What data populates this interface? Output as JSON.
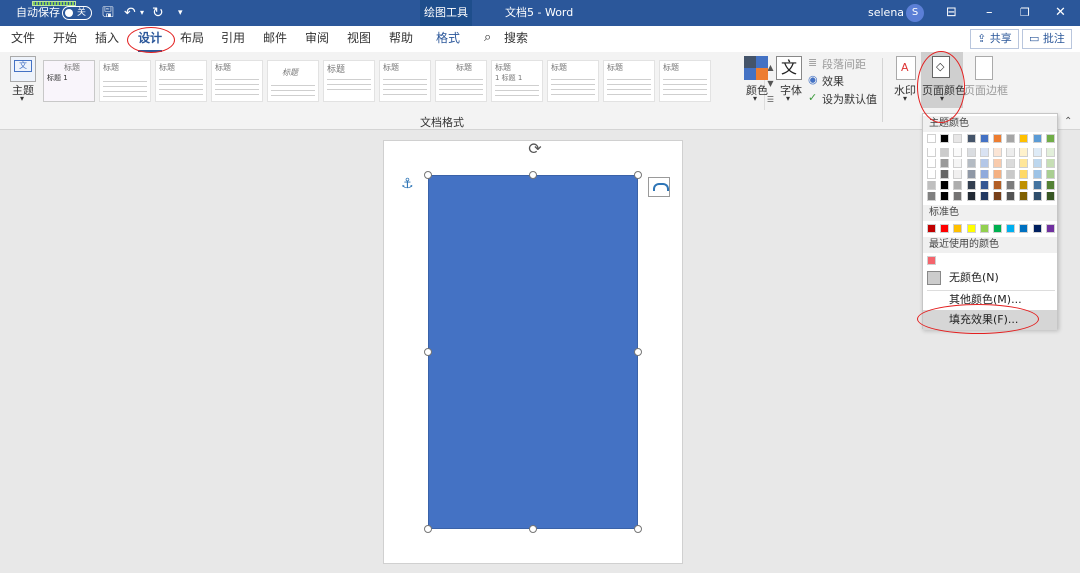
{
  "titlebar": {
    "autosave_label": "自动保存",
    "autosave_toggle": "关",
    "context_tab": "绘图工具",
    "doc_title": "文档5  -  Word",
    "user_name": "selena",
    "user_initial": "S"
  },
  "tabs": [
    "文件",
    "开始",
    "插入",
    "设计",
    "布局",
    "引用",
    "邮件",
    "审阅",
    "视图",
    "帮助",
    "格式"
  ],
  "active_tab": "设计",
  "search_label": "搜索",
  "share_label": "共享",
  "comment_label": "批注",
  "ribbon": {
    "theme_label": "主题",
    "style_gallery": [
      "标题 1",
      "标题",
      "标题",
      "标题",
      "标题",
      "标题",
      "标题",
      "标题",
      "1 标题 1",
      "标题",
      "标题",
      "标题",
      "标题"
    ],
    "group_label": "文档格式",
    "colors_label": "颜色",
    "fonts_label": "字体",
    "font_glyph": "文",
    "paragraph_spacing_label": "段落间距",
    "effects_label": "效果",
    "set_default_label": "设为默认值",
    "watermark_label": "水印",
    "page_color_label": "页面颜色",
    "page_border_label": "页面边框"
  },
  "dropdown": {
    "theme_colors_header": "主题颜色",
    "standard_colors_header": "标准色",
    "recent_colors_header": "最近使用的颜色",
    "no_color_label": "无颜色(N)",
    "more_colors_label": "其他颜色(M)...",
    "fill_effects_label": "填充效果(F)...",
    "theme_top_row": [
      "#ffffff",
      "#000000",
      "#e7e6e6",
      "#44546a",
      "#4472c4",
      "#ed7d31",
      "#a5a5a5",
      "#ffc000",
      "#5b9bd5",
      "#70ad47"
    ],
    "standard_colors": [
      "#c00000",
      "#ff0000",
      "#ffc000",
      "#ffff00",
      "#92d050",
      "#00b050",
      "#00b0f0",
      "#0070c0",
      "#002060",
      "#7030a0"
    ],
    "recent_color": "#f4646c"
  },
  "shape_fill": "#4472c4"
}
